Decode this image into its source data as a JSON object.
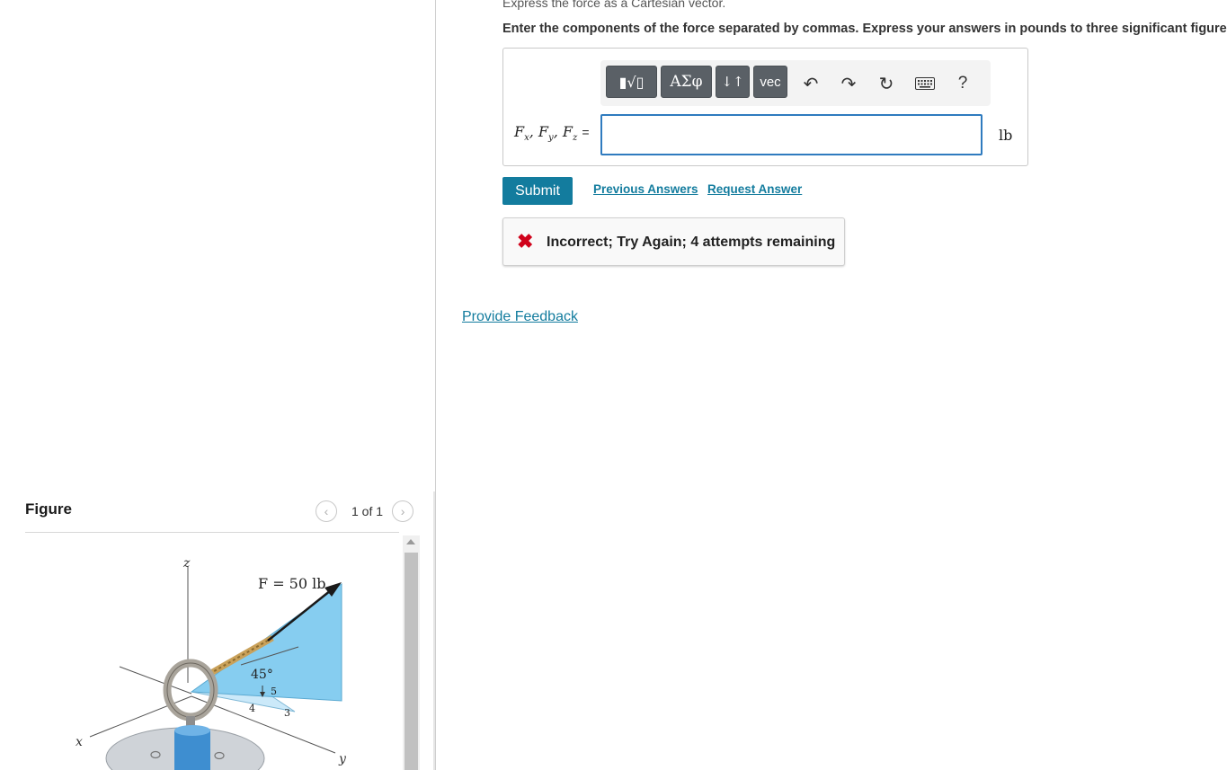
{
  "question": {
    "title": "Express the force as a Cartesian vector.",
    "instructions": "Enter the components of the force separated by commas. Express your answers in pounds to three significant figures."
  },
  "toolbar": {
    "buttons": [
      {
        "name": "templates-icon",
        "label": "▮√▯"
      },
      {
        "name": "greek-symbols-icon",
        "label": "ΑΣφ"
      },
      {
        "name": "updown-arrows-icon",
        "label": "↓↑"
      },
      {
        "name": "vec-icon",
        "label": "vec"
      }
    ],
    "help_label": "?"
  },
  "answer": {
    "label": "Fx, Fy, Fz =",
    "value": "",
    "unit": "lb"
  },
  "actions": {
    "submit_label": "Submit",
    "previous_answers_label": "Previous Answers",
    "request_answer_label": "Request Answer"
  },
  "feedback": {
    "message": "Incorrect; Try Again; 4 attempts remaining",
    "color": "#d0021b"
  },
  "provide_feedback_label": "Provide Feedback",
  "figure": {
    "title": "Figure",
    "page_count": "1 of 1",
    "force_label": "F = 50 lb",
    "angle_label": "45°",
    "axis_z": "z",
    "axis_x": "x",
    "axis_y": "y",
    "slope_hyp": "5",
    "slope_a": "4",
    "slope_b": "3"
  },
  "colors": {
    "accent": "#137c9e",
    "toolbar_button": "#5a6066",
    "plane_fill": "#86cdf0"
  }
}
